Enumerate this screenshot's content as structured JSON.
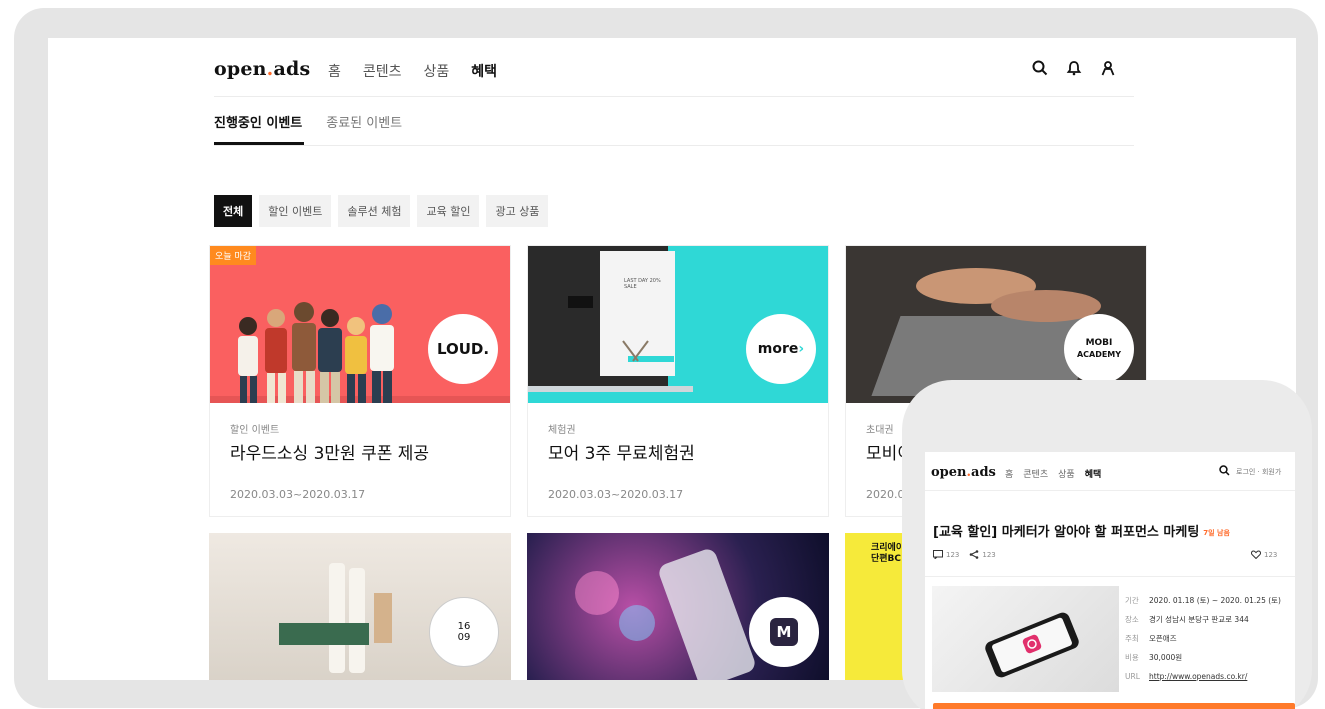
{
  "header": {
    "logo_main": "open",
    "logo_dot": ".",
    "logo_suffix": "ads",
    "nav": [
      "홈",
      "콘텐츠",
      "상품",
      "혜택"
    ],
    "active_nav": "혜택"
  },
  "subtabs": [
    "진행중인 이벤트",
    "종료된 이벤트"
  ],
  "filters": [
    "전체",
    "할인 이벤트",
    "솔루션 체험",
    "교육 할인",
    "광고 상품"
  ],
  "cards": [
    {
      "badge": "오늘 마감",
      "category": "할인 이벤트",
      "title": "라우드소싱 3만원 쿠폰 제공",
      "date": "2020.03.03~2020.03.17",
      "logo": "LOUD."
    },
    {
      "category": "체험권",
      "title": "모어 3주 무료체험권",
      "date": "2020.03.03~2020.03.17",
      "logo": "more",
      "mock_text": "LAST DAY 20% SALE"
    },
    {
      "category": "초대권",
      "title": "모비이",
      "date": "2020.03",
      "logo_line1": "MOBI",
      "logo_line2": "ACADEMY"
    }
  ],
  "bottom_cards": [
    {
      "logo_top": "16",
      "logo_bottom": "09"
    },
    {
      "logo": "M"
    },
    {
      "text_line1": "크리에이",
      "text_line2": "단편BC"
    }
  ],
  "phone": {
    "logo_main": "open",
    "logo_dot": ".",
    "logo_suffix": "ads",
    "nav": [
      "홈",
      "콘텐츠",
      "상품",
      "혜택"
    ],
    "login_text": "로그인 · 회원가",
    "title": "[교육 할인] 마케터가 알아야 할 퍼포먼스 마케팅",
    "title_badge": "7일 남음",
    "comments": "123",
    "shares": "123",
    "likes": "123",
    "info": [
      {
        "key": "기간",
        "value": "2020. 01.18 (토) ~ 2020. 01.25 (토)"
      },
      {
        "key": "장소",
        "value": "경기 성남시 분당구 판교로 344"
      },
      {
        "key": "주최",
        "value": "오픈애즈"
      },
      {
        "key": "비용",
        "value": "30,000원"
      },
      {
        "key": "URL",
        "value": "http://www.openads.co.kr/"
      }
    ]
  },
  "colors": {
    "accent": "#ff6b2b",
    "card1_bg": "#fa6060",
    "card2_bg": "#2fd8d6"
  }
}
